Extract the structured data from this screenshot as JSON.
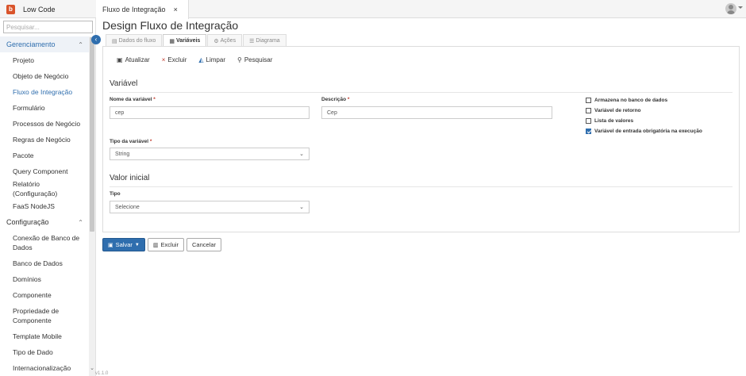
{
  "app": {
    "name": "Low Code",
    "logo_letter": "b"
  },
  "open_tab": {
    "label": "Fluxo de Integração",
    "close": "×"
  },
  "search": {
    "placeholder": "Pesquisar..."
  },
  "sidebar": {
    "groups": [
      {
        "label": "Gerenciamento",
        "items": [
          "Projeto",
          "Objeto de Negócio",
          "Fluxo de Integração",
          "Formulário",
          "Processos de Negócio",
          "Regras de Negócio",
          "Pacote",
          "Query Component",
          "Relatório (Configuração)",
          "FaaS NodeJS"
        ]
      },
      {
        "label": "Configuração",
        "items": [
          "Conexão de Banco de Dados",
          "Banco de Dados",
          "Domínios",
          "Componente",
          "Propriedade de Componente",
          "Template Mobile",
          "Tipo de Dado",
          "Internacionalização"
        ]
      }
    ],
    "active_item": "Fluxo de Integração",
    "footer_text": "v1.1.0"
  },
  "main": {
    "title": "Design Fluxo de Integração",
    "tabs": [
      {
        "label": "Dados do fluxo",
        "icon": "document-icon",
        "active": false
      },
      {
        "label": "Variáveis",
        "icon": "variables-icon",
        "active": true
      },
      {
        "label": "Ações",
        "icon": "actions-icon",
        "active": false
      },
      {
        "label": "Diagrama",
        "icon": "diagram-icon",
        "active": false
      }
    ],
    "toolbar": {
      "refresh": "Atualizar",
      "delete": "Excluir",
      "clear": "Limpar",
      "search": "Pesquisar"
    },
    "variable_section": {
      "title": "Variável",
      "name_label": "Nome da variável",
      "name_value": "cep",
      "description_label": "Descrição",
      "description_value": "Cep",
      "type_label": "Tipo da variável",
      "type_value": "String",
      "checks": [
        {
          "label": "Armazena no banco de dados",
          "checked": false
        },
        {
          "label": "Variável de retorno",
          "checked": false
        },
        {
          "label": "Lista de valores",
          "checked": false
        },
        {
          "label": "Variável de entrada obrigatória na execução",
          "checked": true
        }
      ]
    },
    "initial_value": {
      "title": "Valor inicial",
      "type_label": "Tipo",
      "type_value": "Selecione"
    },
    "actions": {
      "save": "Salvar",
      "delete": "Excluir",
      "cancel": "Cancelar"
    }
  }
}
